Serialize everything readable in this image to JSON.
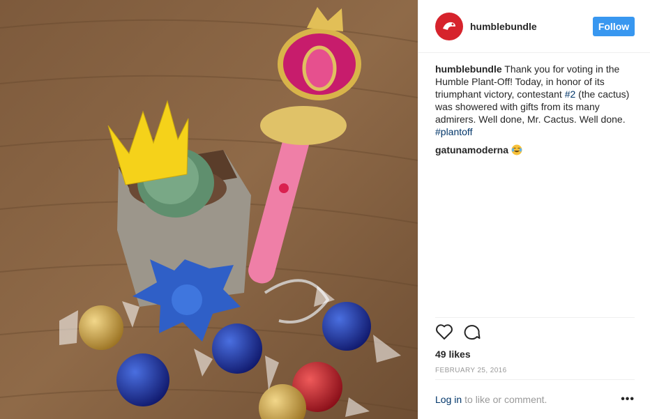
{
  "header": {
    "username": "humblebundle",
    "follow_label": "Follow"
  },
  "caption": {
    "username": "humblebundle",
    "text_before_tag": " Thank you for voting in the Humble Plant-Off! Today, in honor of its triumphant victory, contestant ",
    "mention": "#2",
    "text_after_mention": " (the cactus) was showered with gifts from its many admirers. Well done, Mr. Cactus. Well done.",
    "hashtag": "#plantoff"
  },
  "comments": [
    {
      "username": "gatunamoderna",
      "emoji": "crying-laughing-emoji"
    }
  ],
  "actions": {
    "like_icon": "heart-icon",
    "comment_icon": "comment-icon"
  },
  "likes_text": "49 likes",
  "date_text": "February 25, 2016",
  "footer": {
    "login_link": "Log in",
    "login_suffix": "to like or comment.",
    "more_label": "•••"
  },
  "colors": {
    "follow_bg": "#3897f0",
    "link": "#003569",
    "avatar_bg": "#d6232c"
  }
}
